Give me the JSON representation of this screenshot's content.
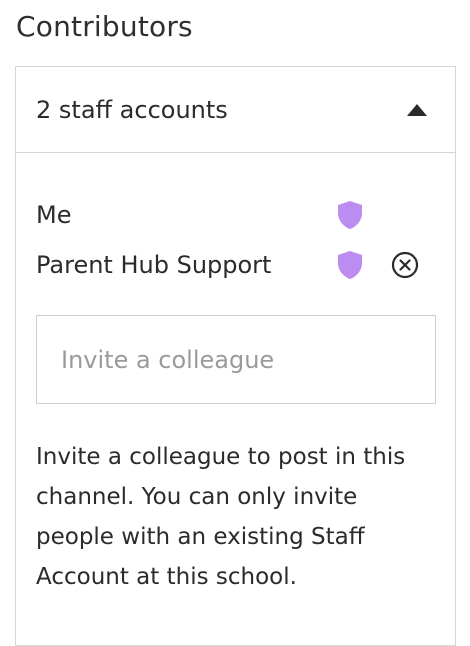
{
  "header": {
    "title": "Contributors"
  },
  "panel": {
    "summary": "2 staff accounts",
    "expanded": true,
    "chevron_icon": "triangle-up-icon"
  },
  "contributors": [
    {
      "name": "Me",
      "icon": "shield-icon",
      "removable": false
    },
    {
      "name": "Parent Hub Support",
      "icon": "shield-icon",
      "removable": true
    }
  ],
  "invite": {
    "placeholder": "Invite a colleague",
    "value": ""
  },
  "help_text": "Invite a colleague to post in this channel. You can only invite people with an existing Staff Account at this school.",
  "colors": {
    "shield": "#bd8cf0",
    "border": "#d6d6d6",
    "text": "#2b2b2b",
    "placeholder": "#9a9a9a"
  }
}
